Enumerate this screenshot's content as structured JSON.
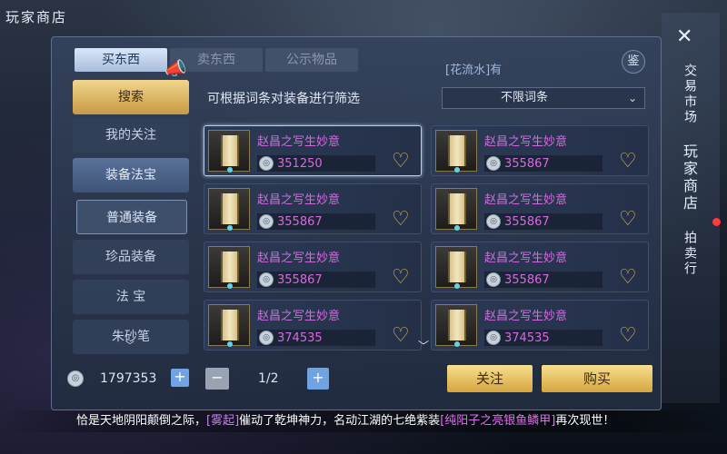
{
  "title": "玩家商店",
  "tabs": [
    "买东西",
    "卖东西",
    "公示物品"
  ],
  "marquee": "[花流水]有",
  "appraise": "鉴",
  "sidebar": [
    "搜索",
    "我的关注",
    "装备法宝",
    "普通装备",
    "珍品装备",
    "法 宝",
    "朱砂笔"
  ],
  "filter": {
    "label": "可根据词条对装备进行筛选",
    "value": "不限词条"
  },
  "items": [
    {
      "name": "赵昌之写生妙意",
      "price": "351250"
    },
    {
      "name": "赵昌之写生妙意",
      "price": "355867"
    },
    {
      "name": "赵昌之写生妙意",
      "price": "355867"
    },
    {
      "name": "赵昌之写生妙意",
      "price": "355867"
    },
    {
      "name": "赵昌之写生妙意",
      "price": "355867"
    },
    {
      "name": "赵昌之写生妙意",
      "price": "355867"
    },
    {
      "name": "赵昌之写生妙意",
      "price": "374535"
    },
    {
      "name": "赵昌之写生妙意",
      "price": "374535"
    }
  ],
  "footer": {
    "money": "1797353",
    "page": "1/2",
    "follow": "关注",
    "buy": "购买"
  },
  "ticker": {
    "p1": "恰是天地阴阳颠倒之际，",
    "n1": "[雾起]",
    "p2": "催动了乾坤神力，名动江湖的七绝紫装",
    "n2": "[纯阳子之亮银鱼鳞甲]",
    "p3": "再次现世！"
  },
  "rightnav": [
    "交易市场",
    "玩家商店",
    "拍卖行"
  ],
  "colors": {
    "item_name": "#d46adf",
    "gold_button": "#e6bf5c",
    "accent_blue": "#6fa3e2"
  }
}
